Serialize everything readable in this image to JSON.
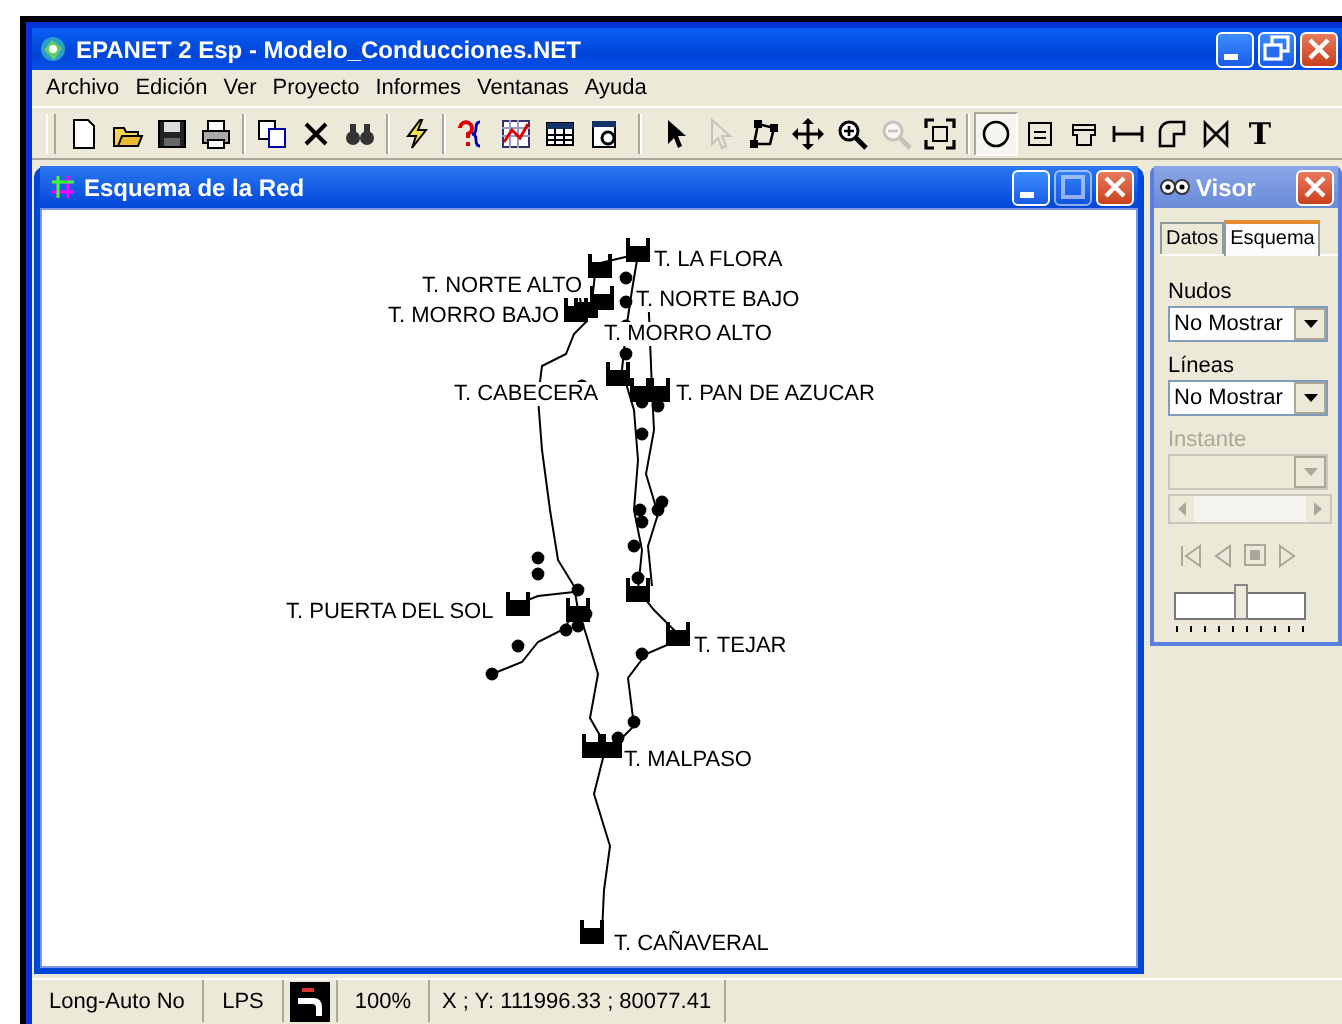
{
  "window": {
    "title": "EPANET 2 Esp - Modelo_Conducciones.NET"
  },
  "menu": [
    "Archivo",
    "Edición",
    "Ver",
    "Proyecto",
    "Informes",
    "Ventanas",
    "Ayuda"
  ],
  "toolbar": [
    {
      "kind": "new",
      "disabled": false,
      "selected": false
    },
    {
      "kind": "open",
      "disabled": false,
      "selected": false
    },
    {
      "kind": "save",
      "disabled": false,
      "selected": false
    },
    {
      "kind": "print",
      "disabled": false,
      "selected": false
    },
    {
      "kind": "sep"
    },
    {
      "kind": "copy",
      "disabled": false,
      "selected": false
    },
    {
      "kind": "delete",
      "disabled": false,
      "selected": false
    },
    {
      "kind": "find",
      "disabled": false,
      "selected": false
    },
    {
      "kind": "sep"
    },
    {
      "kind": "run",
      "disabled": false,
      "selected": false
    },
    {
      "kind": "sep"
    },
    {
      "kind": "query",
      "disabled": false,
      "selected": false
    },
    {
      "kind": "graph",
      "disabled": false,
      "selected": false
    },
    {
      "kind": "table",
      "disabled": false,
      "selected": false
    },
    {
      "kind": "options",
      "disabled": false,
      "selected": false
    },
    {
      "kind": "bigsep"
    },
    {
      "kind": "select",
      "disabled": false,
      "selected": false
    },
    {
      "kind": "vertex",
      "disabled": true,
      "selected": false
    },
    {
      "kind": "polygon",
      "disabled": false,
      "selected": false
    },
    {
      "kind": "pan",
      "disabled": false,
      "selected": false
    },
    {
      "kind": "zoomin",
      "disabled": false,
      "selected": false
    },
    {
      "kind": "zoomout",
      "disabled": true,
      "selected": false
    },
    {
      "kind": "extent",
      "disabled": false,
      "selected": false
    },
    {
      "kind": "sep"
    },
    {
      "kind": "junction",
      "disabled": false,
      "selected": true
    },
    {
      "kind": "reservoir",
      "disabled": false,
      "selected": false
    },
    {
      "kind": "tank",
      "disabled": false,
      "selected": false
    },
    {
      "kind": "pipe",
      "disabled": false,
      "selected": false
    },
    {
      "kind": "pump",
      "disabled": false,
      "selected": false
    },
    {
      "kind": "valve",
      "disabled": false,
      "selected": false
    },
    {
      "kind": "text",
      "label": "T",
      "disabled": false,
      "selected": false
    }
  ],
  "map_window": {
    "title": "Esquema de la Red",
    "labels": [
      "T. LA FLORA",
      "T. NORTE ALTO",
      "T. NORTE BAJO",
      "T. MORRO BAJO",
      "T. MORRO ALTO",
      "T. CABECERA",
      "T. PAN DE AZUCAR",
      "T. PUERTA DEL SOL",
      "T. TEJAR",
      "T. MALPASO",
      "T. CAÑAVERAL"
    ]
  },
  "visor": {
    "title": "Visor",
    "tabs": [
      {
        "label": "Datos",
        "selected": false
      },
      {
        "label": "Esquema",
        "selected": true
      }
    ],
    "fields": [
      {
        "label": "Nudos",
        "value": "No Mostrar",
        "disabled": false
      },
      {
        "label": "Líneas",
        "value": "No Mostrar",
        "disabled": false
      },
      {
        "label": "Instante",
        "disabled": true
      }
    ],
    "player_disabled": true,
    "speed": {
      "level": 0.5
    }
  },
  "status_bar": [
    {
      "kind": "text",
      "text": "Long-Auto No"
    },
    {
      "kind": "text",
      "text": "LPS"
    },
    {
      "kind": "icon"
    },
    {
      "kind": "text",
      "text": "100%"
    },
    {
      "kind": "text",
      "text": "X ; Y: 111996.33 ;  80077.41"
    }
  ]
}
